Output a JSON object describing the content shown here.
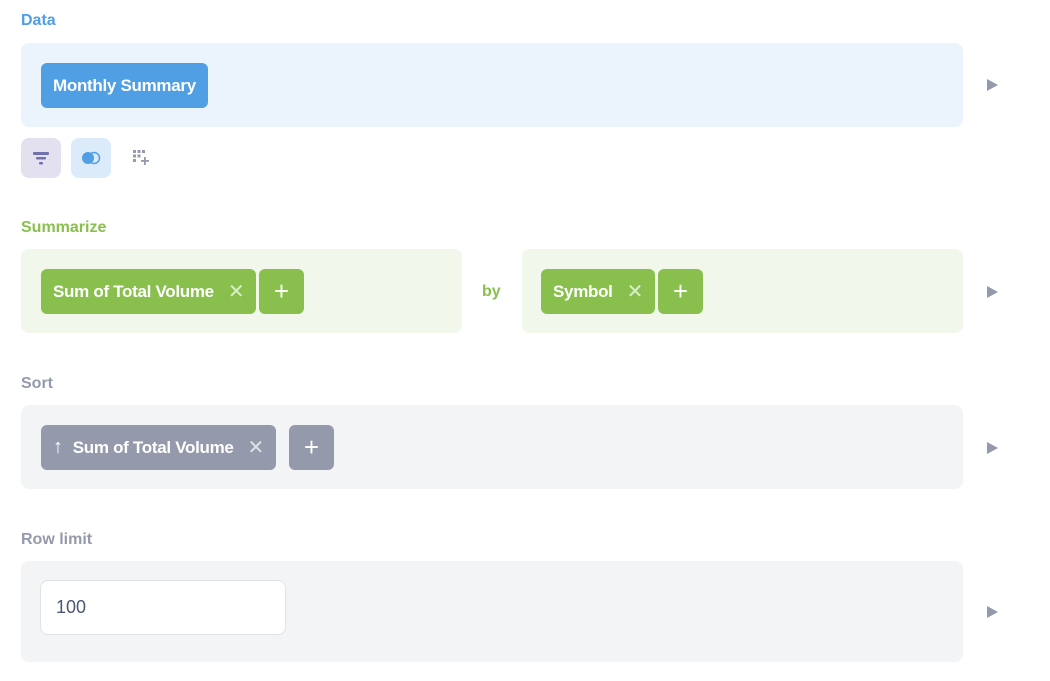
{
  "data": {
    "label": "Data",
    "table": "Monthly Summary"
  },
  "summarize": {
    "label": "Summarize",
    "metric": "Sum of Total Volume",
    "by": "by",
    "breakout": "Symbol"
  },
  "sort": {
    "label": "Sort",
    "field": "Sum of Total Volume",
    "direction": "ascending"
  },
  "row_limit": {
    "label": "Row limit",
    "value": "100"
  },
  "colors": {
    "data": "#509ee3",
    "summarize": "#88bf4d",
    "sort": "#949aab"
  }
}
